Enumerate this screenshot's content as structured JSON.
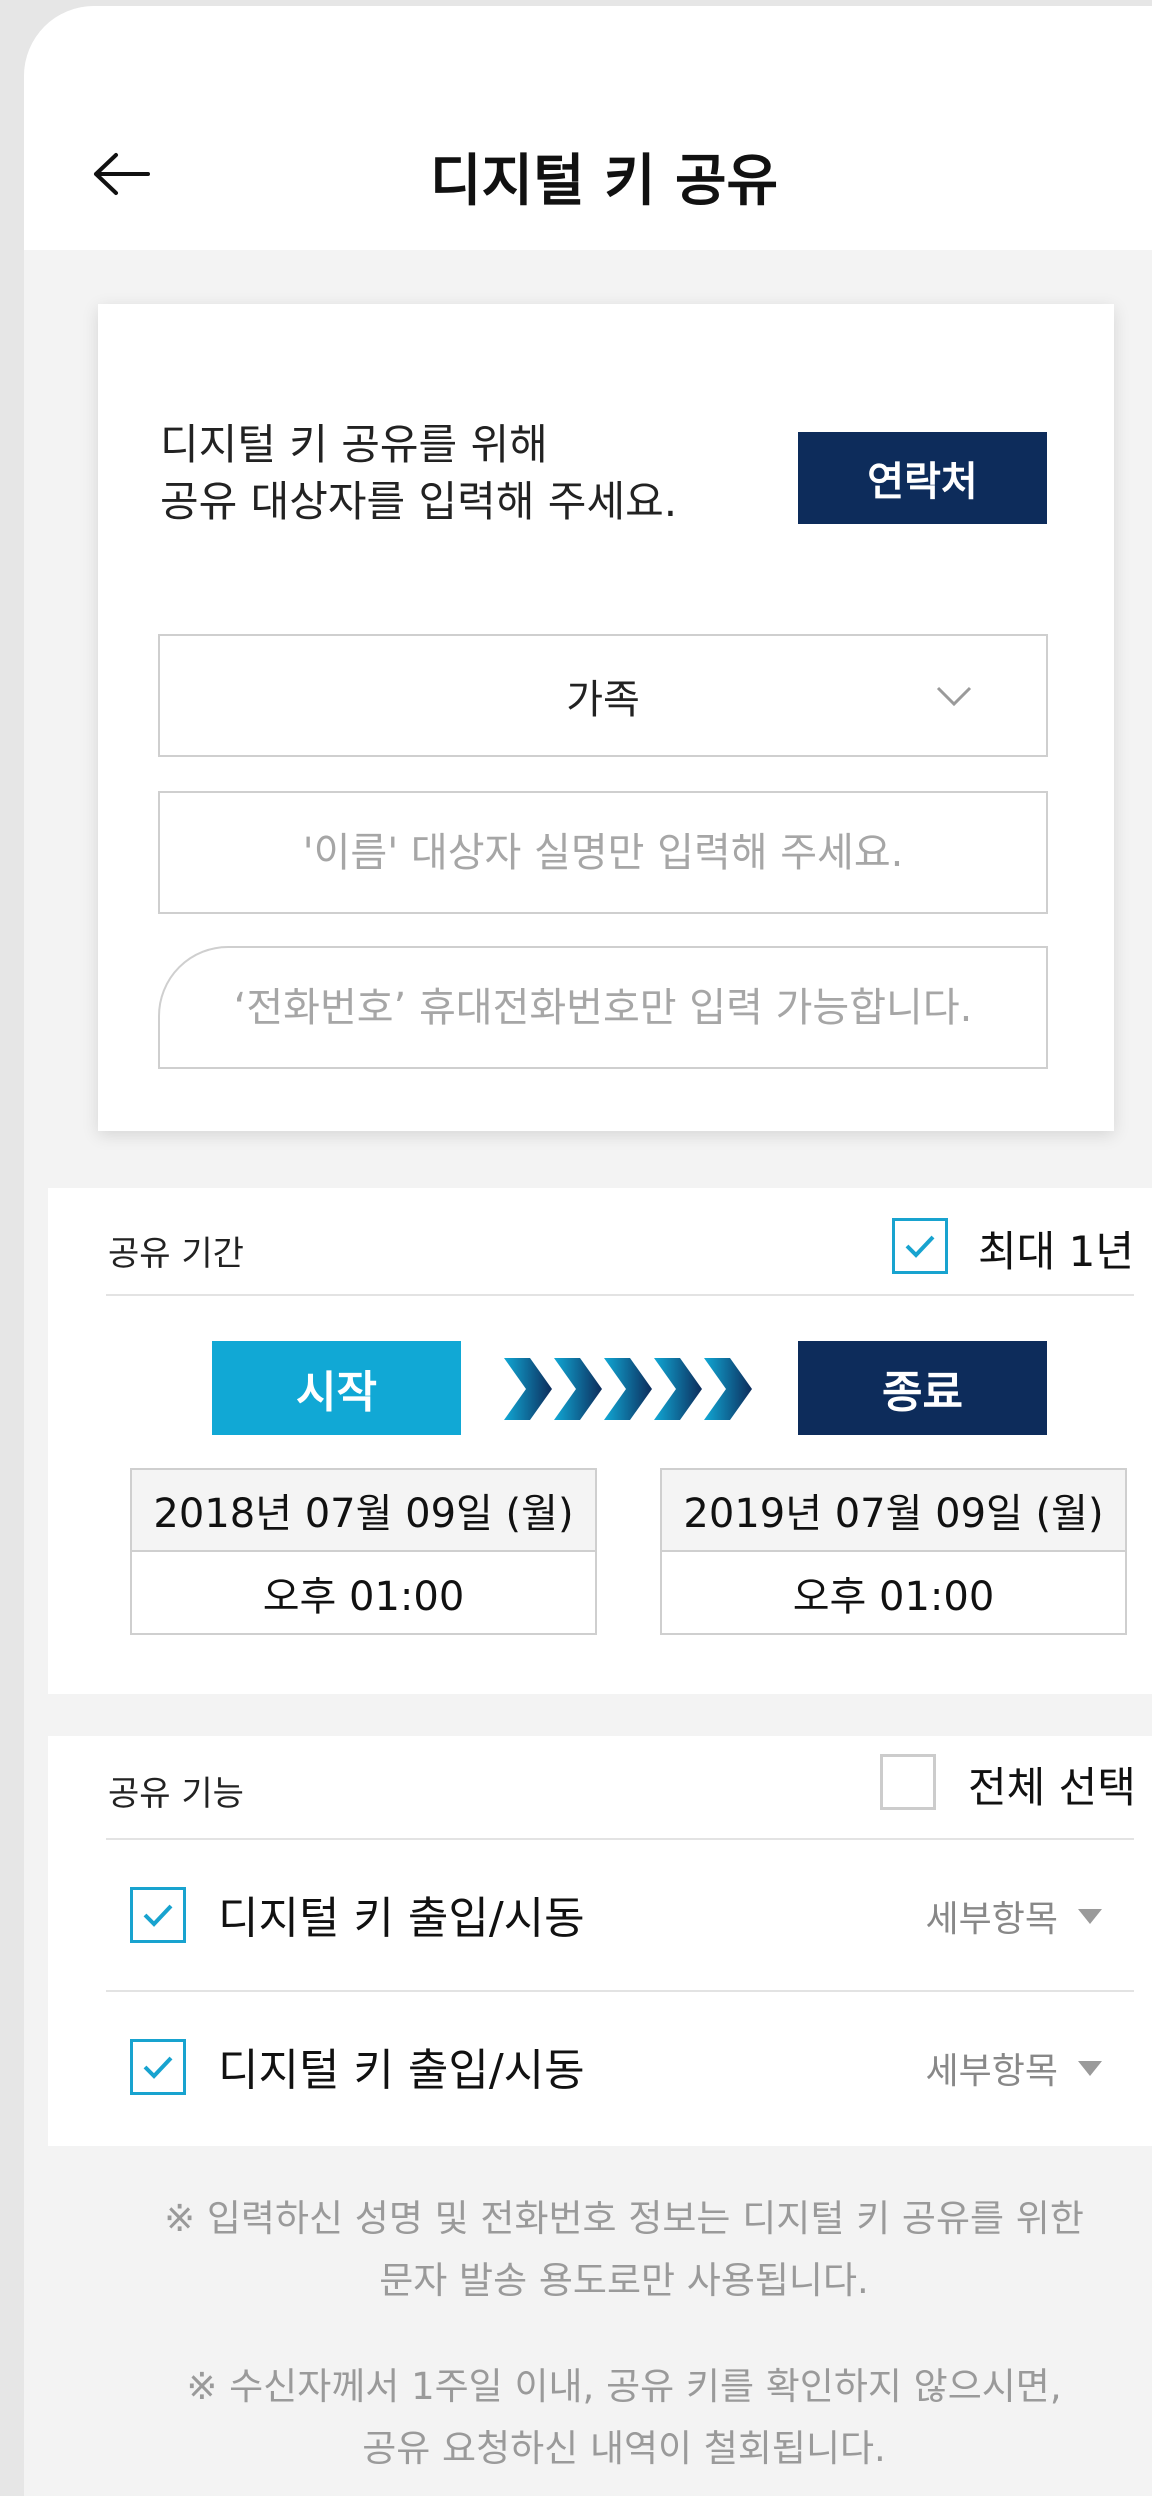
{
  "header": {
    "title": "디지털 키 공유",
    "back_icon": "arrow-left-icon"
  },
  "recipient": {
    "instruction_line1": "디지털 키 공유를 위해",
    "instruction_line2": "공유 대상자를 입력해 주세요.",
    "contact_button": "연락처",
    "relation_value": "가족",
    "name_placeholder": "'이름' 대상자 실명만 입력해 주세요.",
    "phone_placeholder": "‘전화번호’ 휴대전화번호만 입력 가능합니다."
  },
  "period": {
    "label": "공유 기간",
    "max_label": "최대 1년",
    "max_checked": true,
    "start_label": "시작",
    "end_label": "종료",
    "start_date": "2018년 07월 09일 (월)",
    "start_time": "오후 01:00",
    "end_date": "2019년 07월 09일 (월)",
    "end_time": "오후 01:00"
  },
  "functions": {
    "label": "공유 기능",
    "select_all_label": "전체 선택",
    "select_all_checked": false,
    "items": [
      {
        "name": "디지털 키 출입/시동",
        "checked": true,
        "detail_label": "세부항목"
      },
      {
        "name": "디지털 키 출입/시동",
        "checked": true,
        "detail_label": "세부항목"
      }
    ]
  },
  "notices": {
    "notice1_line1": "※ 입력하신 성명 및 전화번호 정보는 디지털 키 공유를 위한",
    "notice1_line2": "문자 발송 용도로만 사용됩니다.",
    "notice2_line1": "※ 수신자께서 1주일 이내, 공유 키를 확인하지 않으시면,",
    "notice2_line2": "공유 요청하신 내역이 철회됩니다."
  },
  "colors": {
    "navy": "#0d2c5b",
    "cyan": "#11a8d5",
    "check": "#18a3cf",
    "notice_text": "#9a9a9a"
  }
}
